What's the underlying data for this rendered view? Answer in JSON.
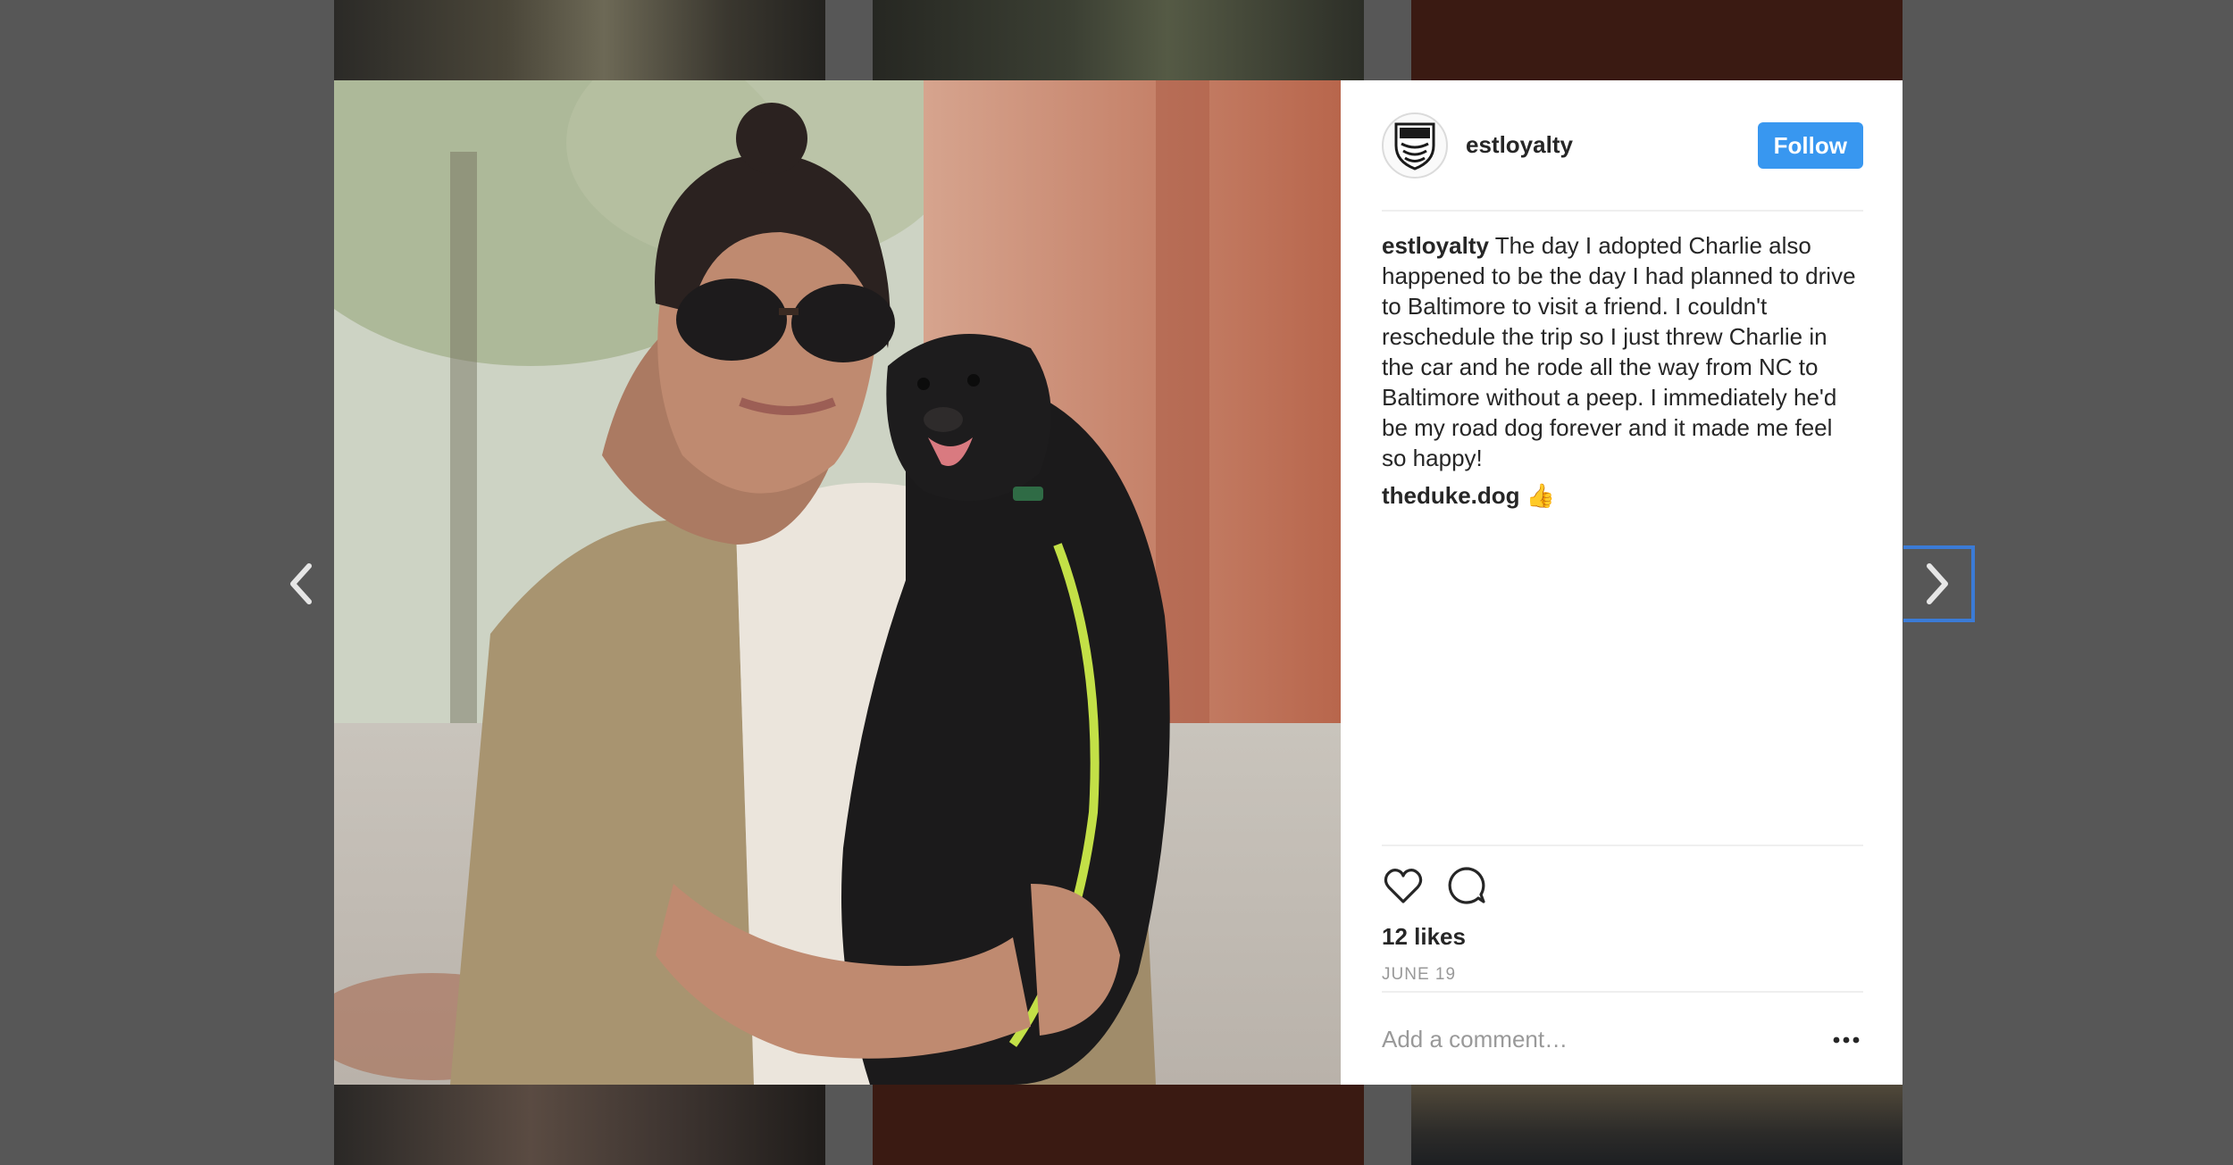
{
  "background_tiles": [
    "tile-a",
    "tile-b",
    "tile-c",
    "tile-d",
    "tile-e",
    "tile-f"
  ],
  "post": {
    "username": "estloyalty",
    "follow_label": "Follow",
    "caption_user": "estloyalty",
    "caption_text": " The day I adopted Charlie also happened to be the day I had planned to drive to Baltimore to visit a friend. I couldn't reschedule the trip so I just threw Charlie in the car and he rode all the way from NC to Baltimore without a peep. I immediately he'd be my road dog forever and it made me feel so happy!",
    "reply_user": "theduke.dog",
    "reply_text": " 👍",
    "likes": "12 likes",
    "date": "JUNE 19",
    "comment_placeholder": "Add a comment…"
  },
  "icons": {
    "like": "heart-icon",
    "comment": "comment-icon",
    "more": "more-options-icon",
    "prev": "chevron-left-icon",
    "next": "chevron-right-icon"
  },
  "colors": {
    "follow_bg": "#3897f0",
    "overlay": "#575757",
    "focus": "#3b7bd6"
  }
}
